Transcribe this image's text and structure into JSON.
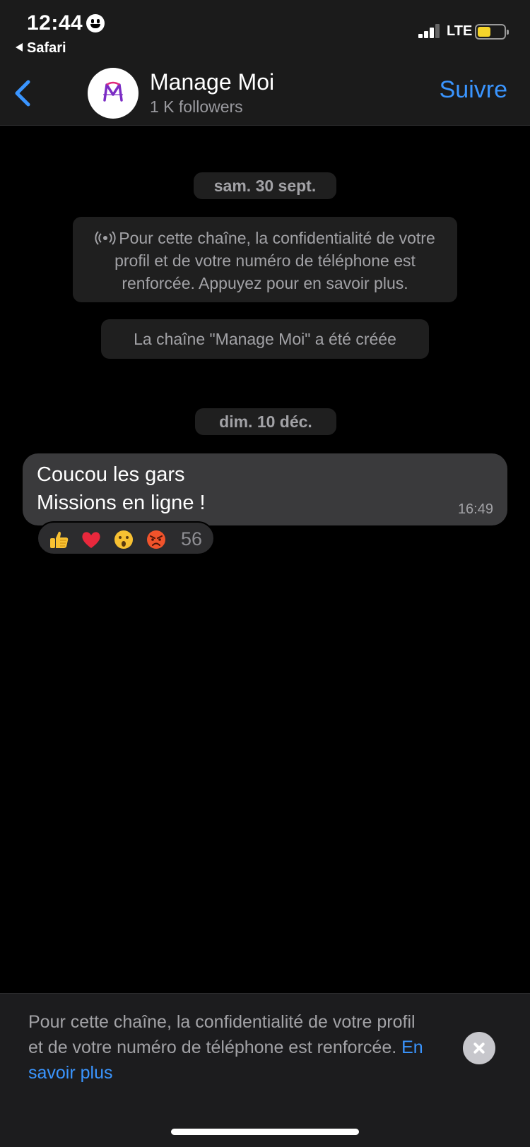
{
  "status_bar": {
    "time": "12:44",
    "back_app": "Safari",
    "network": "LTE",
    "battery_level": 0.5
  },
  "header": {
    "channel_name": "Manage Moi",
    "followers": "1 K followers",
    "follow_label": "Suivre"
  },
  "chat": {
    "date_1": "sam. 30 sept.",
    "privacy_notice": "Pour cette chaîne, la confidentialité de votre profil et de votre numéro de téléphone est renforcée. Appuyez pour en savoir plus.",
    "created_notice": "La chaîne \"Manage Moi\" a été créée",
    "date_2": "dim. 10 déc.",
    "message": {
      "line_1": "Coucou les gars",
      "line_2": "Missions en ligne !",
      "time": "16:49"
    },
    "reactions": {
      "emojis": [
        "thumbs-up",
        "red-heart",
        "surprised-face",
        "angry-face"
      ],
      "count": "56"
    }
  },
  "banner": {
    "text": "Pour cette chaîne, la confidentialité de votre profil et de votre numéro de téléphone est renforcée.",
    "link": "En savoir plus"
  },
  "colors": {
    "accent": "#3a95ff",
    "bubble": "#3a3a3c",
    "pill": "#1f1f1f",
    "battery": "#f5d42a"
  }
}
